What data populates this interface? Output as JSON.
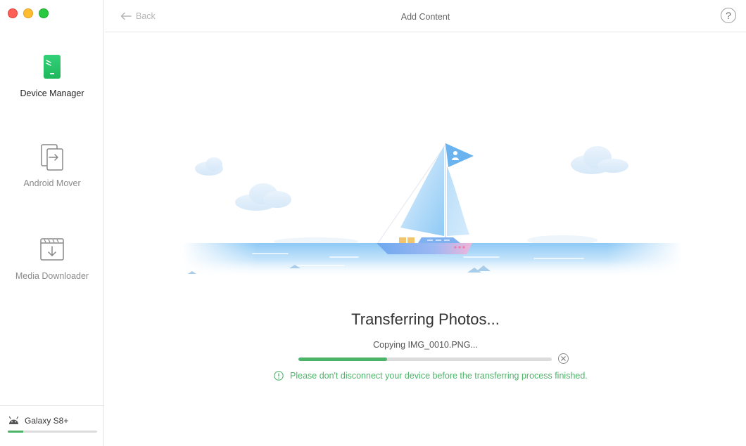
{
  "window": {
    "controls": [
      "close",
      "minimize",
      "maximize"
    ]
  },
  "sidebar": {
    "items": [
      {
        "label": "Device Manager",
        "icon": "phone-icon",
        "active": true
      },
      {
        "label": "Android Mover",
        "icon": "transfer-icon",
        "active": false
      },
      {
        "label": "Media Downloader",
        "icon": "download-icon",
        "active": false
      }
    ],
    "device": {
      "name": "Galaxy S8+",
      "icon": "android-icon",
      "storage_used": 0.17
    }
  },
  "header": {
    "back_label": "Back",
    "title": "Add Content",
    "help_label": "?"
  },
  "main": {
    "status_title": "Transferring Photos...",
    "status_subtitle": "Copying IMG_0010.PNG...",
    "progress": 0.35,
    "warning": "Please don't disconnect your device before the transferring process finished."
  },
  "colors": {
    "accent": "#4cb469",
    "active_icon": "#2ecc71",
    "inactive_icon": "#999999"
  }
}
